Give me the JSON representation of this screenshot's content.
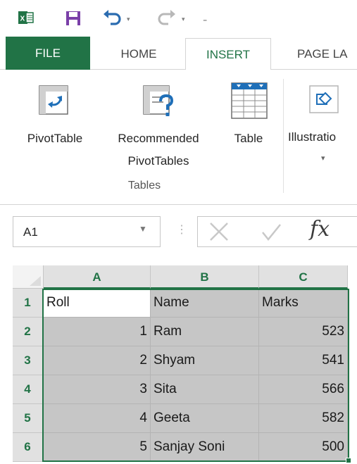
{
  "quick_access": {
    "icons": [
      "excel-logo-icon",
      "save-icon",
      "undo-icon",
      "redo-icon",
      "customize-icon"
    ],
    "colors": {
      "save": "#7a3fa8",
      "undo": "#2b6cb0"
    }
  },
  "ribbon": {
    "tabs": [
      {
        "label": "FILE",
        "active": false
      },
      {
        "label": "HOME",
        "active": false
      },
      {
        "label": "INSERT",
        "active": true
      },
      {
        "label": "PAGE LA",
        "active": false
      }
    ],
    "buttons": {
      "pivot_table": "PivotTable",
      "recommended_line1": "Recommended",
      "recommended_line2": "PivotTables",
      "table": "Table",
      "illustrations": "Illustratio"
    },
    "group_label": "Tables",
    "accent": "#217346"
  },
  "formula_bar": {
    "name_box": "A1",
    "fx_label": "fx"
  },
  "sheet": {
    "columns": [
      "A",
      "B",
      "C"
    ],
    "rows": [
      "1",
      "2",
      "3",
      "4",
      "5",
      "6"
    ],
    "header": {
      "a": "Roll",
      "b": "Name",
      "c": "Marks"
    },
    "data": [
      {
        "a": "1",
        "b": "Ram",
        "c": "523"
      },
      {
        "a": "2",
        "b": "Shyam",
        "c": "541"
      },
      {
        "a": "3",
        "b": "Sita",
        "c": "566"
      },
      {
        "a": "4",
        "b": "Geeta",
        "c": "582"
      },
      {
        "a": "5",
        "b": "Sanjay Soni",
        "c": "500"
      }
    ],
    "selection_color": "#217346"
  }
}
